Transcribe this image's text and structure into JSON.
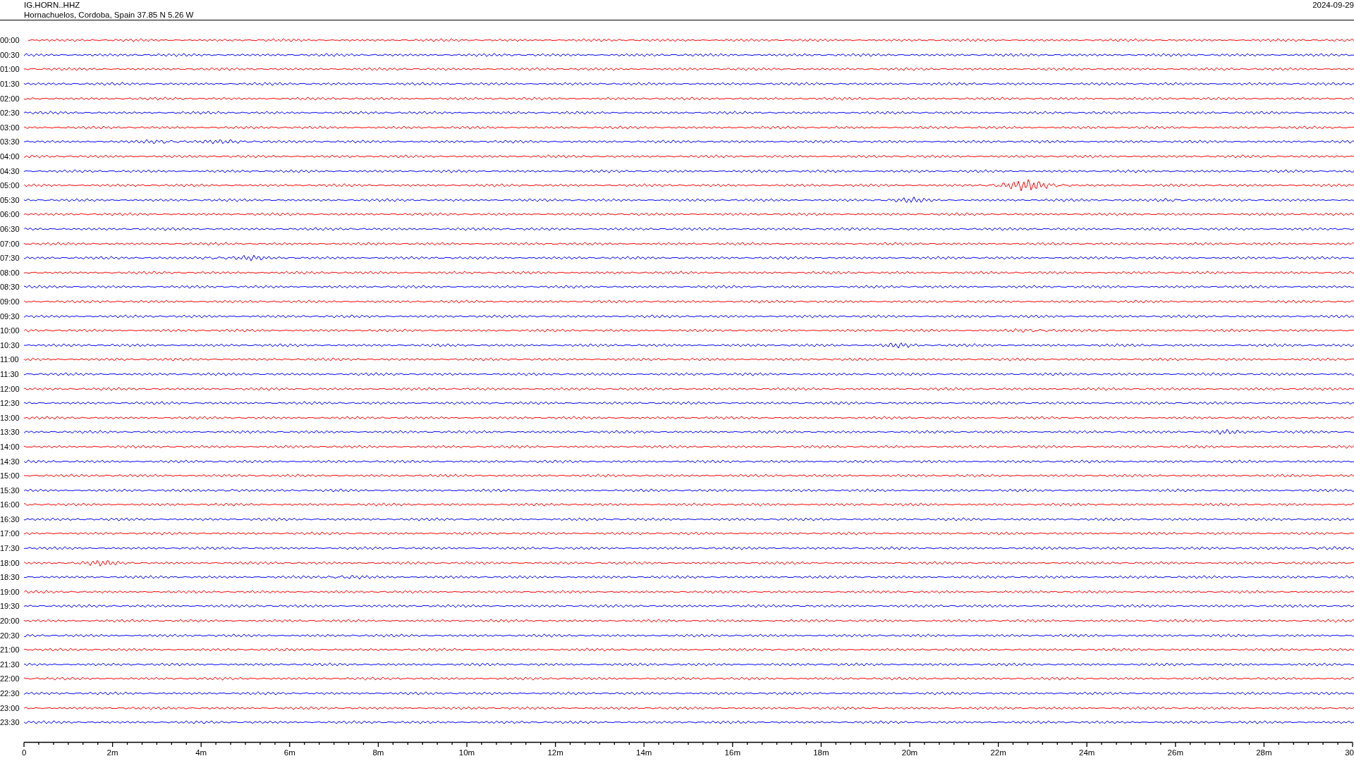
{
  "header": {
    "station": "IG.HORN..HHZ",
    "location": "Hornachuelos, Cordoba, Spain  37.85 N 5.26 W",
    "date": "2024-09-29"
  },
  "rows": [
    {
      "time": "00:00",
      "color": "#ff0000"
    },
    {
      "time": "00:30",
      "color": "#0000ff"
    },
    {
      "time": "01:00",
      "color": "#ff0000"
    },
    {
      "time": "01:30",
      "color": "#0000ff"
    },
    {
      "time": "02:00",
      "color": "#ff0000"
    },
    {
      "time": "02:30",
      "color": "#0000ff"
    },
    {
      "time": "03:00",
      "color": "#ff0000"
    },
    {
      "time": "03:30",
      "color": "#0000ff"
    },
    {
      "time": "04:00",
      "color": "#ff0000"
    },
    {
      "time": "04:30",
      "color": "#0000ff"
    },
    {
      "time": "05:00",
      "color": "#ff0000"
    },
    {
      "time": "05:30",
      "color": "#0000ff"
    },
    {
      "time": "06:00",
      "color": "#ff0000"
    },
    {
      "time": "06:30",
      "color": "#0000ff"
    },
    {
      "time": "07:00",
      "color": "#ff0000"
    },
    {
      "time": "07:30",
      "color": "#0000ff"
    },
    {
      "time": "08:00",
      "color": "#ff0000"
    },
    {
      "time": "08:30",
      "color": "#0000ff"
    },
    {
      "time": "09:00",
      "color": "#ff0000"
    },
    {
      "time": "09:30",
      "color": "#0000ff"
    },
    {
      "time": "10:00",
      "color": "#ff0000"
    },
    {
      "time": "10:30",
      "color": "#0000ff"
    },
    {
      "time": "11:00",
      "color": "#ff0000"
    },
    {
      "time": "11:30",
      "color": "#0000ff"
    },
    {
      "time": "12:00",
      "color": "#ff0000"
    },
    {
      "time": "12:30",
      "color": "#0000ff"
    },
    {
      "time": "13:00",
      "color": "#ff0000"
    },
    {
      "time": "13:30",
      "color": "#0000ff"
    },
    {
      "time": "14:00",
      "color": "#ff0000"
    },
    {
      "time": "14:30",
      "color": "#0000ff"
    },
    {
      "time": "15:00",
      "color": "#ff0000"
    },
    {
      "time": "15:30",
      "color": "#0000ff"
    },
    {
      "time": "16:00",
      "color": "#ff0000"
    },
    {
      "time": "16:30",
      "color": "#0000ff"
    },
    {
      "time": "17:00",
      "color": "#ff0000"
    },
    {
      "time": "17:30",
      "color": "#0000ff"
    },
    {
      "time": "18:00",
      "color": "#ff0000"
    },
    {
      "time": "18:30",
      "color": "#0000ff"
    },
    {
      "time": "19:00",
      "color": "#ff0000"
    },
    {
      "time": "19:30",
      "color": "#0000ff"
    },
    {
      "time": "20:00",
      "color": "#ff0000"
    },
    {
      "time": "20:30",
      "color": "#0000ff"
    },
    {
      "time": "21:00",
      "color": "#ff0000"
    },
    {
      "time": "21:30",
      "color": "#0000ff"
    },
    {
      "time": "22:00",
      "color": "#ff0000"
    },
    {
      "time": "22:30",
      "color": "#0000ff"
    },
    {
      "time": "23:00",
      "color": "#ff0000"
    },
    {
      "time": "23:30",
      "color": "#0000ff"
    }
  ],
  "axis": {
    "ticks": [
      "0",
      "2m",
      "4m",
      "6m",
      "8m",
      "10m",
      "12m",
      "14m",
      "16m",
      "18m",
      "20m",
      "22m",
      "24m",
      "26m",
      "28m",
      "30"
    ]
  }
}
